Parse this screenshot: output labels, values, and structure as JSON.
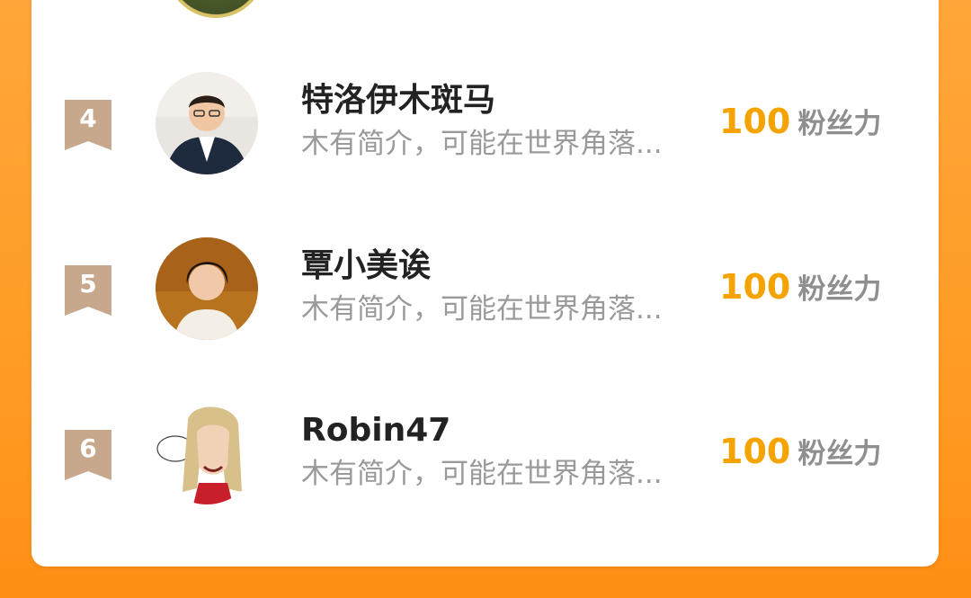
{
  "leaderboard": {
    "rows": [
      {
        "rank": "4",
        "name": "特洛伊木斑马",
        "bio": "木有简介，可能在世界角落...",
        "fans_count": "100",
        "fans_label": "粉丝力"
      },
      {
        "rank": "5",
        "name": "覃小美诶",
        "bio": "木有简介，可能在世界角落...",
        "fans_count": "100",
        "fans_label": "粉丝力"
      },
      {
        "rank": "6",
        "name": "Robin47",
        "bio": "木有简介，可能在世界角落...",
        "fans_count": "100",
        "fans_label": "粉丝力"
      }
    ]
  },
  "colors": {
    "background": "#ff9c25",
    "card": "#ffffff",
    "fans_count": "#f5a300",
    "rank_badge": "#c7a88c",
    "name": "#222222",
    "bio": "#9a9a9a"
  },
  "icons": {
    "rank_badge": "ribbon-badge-icon"
  }
}
